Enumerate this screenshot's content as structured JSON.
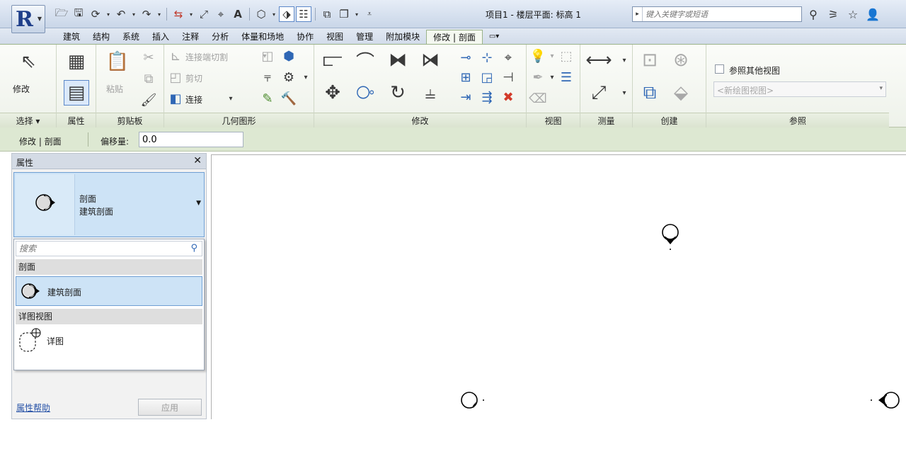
{
  "app": {
    "window_title": "项目1 - 楼层平面: 标高 1",
    "search_placeholder": "键入关键字或短语"
  },
  "ribbon_tabs": [
    {
      "label": "建筑"
    },
    {
      "label": "结构"
    },
    {
      "label": "系统"
    },
    {
      "label": "插入"
    },
    {
      "label": "注释"
    },
    {
      "label": "分析"
    },
    {
      "label": "体量和场地"
    },
    {
      "label": "协作"
    },
    {
      "label": "视图"
    },
    {
      "label": "管理"
    },
    {
      "label": "附加模块"
    },
    {
      "label": "修改 | 剖面"
    }
  ],
  "ribbon": {
    "panels": {
      "select": "选择 ▾",
      "properties": "属性",
      "clipboard": "剪贴板",
      "geometry": "几何图形",
      "modify": "修改",
      "view": "视图",
      "measure": "测量",
      "create": "创建",
      "reference": "参照"
    },
    "modify_label": "修改",
    "paste_label": "粘贴",
    "cut_geometry_label": "连接端切割",
    "cut_label": "剪切",
    "join_label": "连接",
    "reference_other_view_label": "参照其他视图",
    "new_view_placeholder": "<新绘图视图>"
  },
  "options_bar": {
    "context": "修改 | 剖面",
    "offset_label": "偏移量:",
    "offset_value": "0.0"
  },
  "properties": {
    "title": "属性",
    "type_family": "剖面",
    "type_name": "建筑剖面",
    "search_placeholder": "搜索",
    "groups": [
      {
        "header": "剖面",
        "items": [
          {
            "label": "建筑剖面",
            "selected": true
          }
        ]
      },
      {
        "header": "详图视图",
        "items": [
          {
            "label": "详图",
            "selected": false
          }
        ]
      }
    ],
    "help_link": "属性帮助",
    "apply_label": "应用"
  },
  "colors": {
    "ribbon_accent": "#9bb38a",
    "selection_blue": "#cde3f6",
    "link_blue": "#2450a6"
  }
}
